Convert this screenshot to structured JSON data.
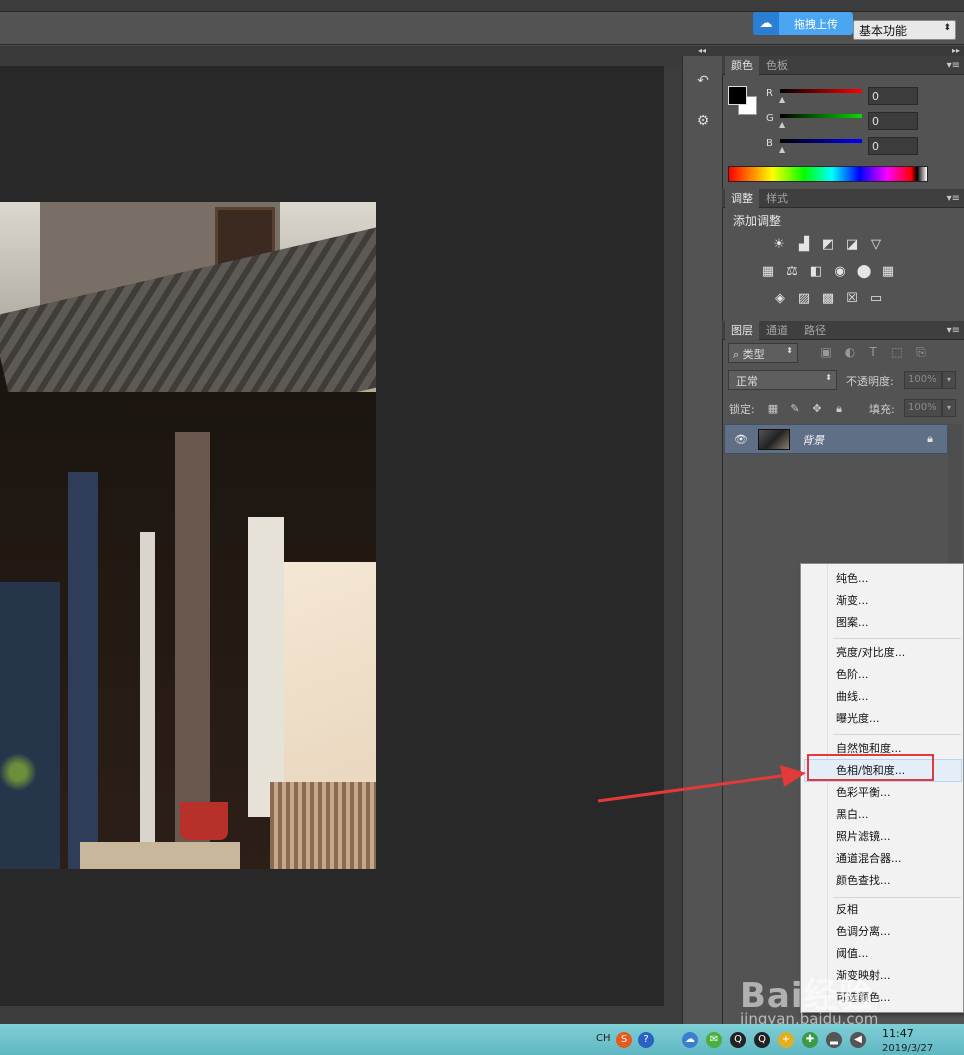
{
  "optionsbar": {
    "upload_label": "拖拽上传",
    "workspace": "基本功能"
  },
  "color_panel": {
    "tabs": [
      "颜色",
      "色板"
    ],
    "channels": [
      {
        "label": "R",
        "value": "0",
        "color": "#ff0000"
      },
      {
        "label": "G",
        "value": "0",
        "color": "#00dd00"
      },
      {
        "label": "B",
        "value": "0",
        "color": "#0000ff"
      }
    ]
  },
  "adjust_panel": {
    "tabs": [
      "调整",
      "样式"
    ],
    "title": "添加调整",
    "icons": [
      "brightness-icon",
      "levels-icon",
      "curves-icon",
      "exposure-icon",
      "vibrance-icon",
      "hue-saturation-icon",
      "color-balance-icon",
      "black-white-icon",
      "photo-filter-icon",
      "channel-mixer-icon",
      "color-lookup-icon",
      "invert-icon",
      "posterize-icon",
      "threshold-icon",
      "selective-color-icon",
      "gradient-map-icon"
    ]
  },
  "layers_panel": {
    "tabs": [
      "图层",
      "通道",
      "路径"
    ],
    "filter_label": "类型",
    "blend_mode": "正常",
    "opacity_label": "不透明度:",
    "opacity_value": "100%",
    "lock_label": "锁定:",
    "fill_label": "填充:",
    "fill_value": "100%",
    "layer_name": "背景"
  },
  "context_menu": {
    "groups": [
      [
        "纯色...",
        "渐变...",
        "图案..."
      ],
      [
        "亮度/对比度...",
        "色阶...",
        "曲线...",
        "曝光度..."
      ],
      [
        "自然饱和度...",
        "色相/饱和度...",
        "色彩平衡...",
        "黑白...",
        "照片滤镜...",
        "通道混合器...",
        "颜色查找..."
      ],
      [
        "反相",
        "色调分离...",
        "阈值...",
        "渐变映射...",
        "可选颜色..."
      ]
    ],
    "highlighted": "色相/饱和度..."
  },
  "taskbar": {
    "lang": "CH",
    "time": "11:47",
    "date": "2019/3/27"
  },
  "watermark": {
    "brand": "Bai经验",
    "url": "jingyan.baidu.com"
  },
  "colors": {
    "accent_highlight": "#e03a3a",
    "selected_layer": "#5f6f86",
    "panel_bg": "#535353",
    "canvas_bg": "#282828"
  }
}
